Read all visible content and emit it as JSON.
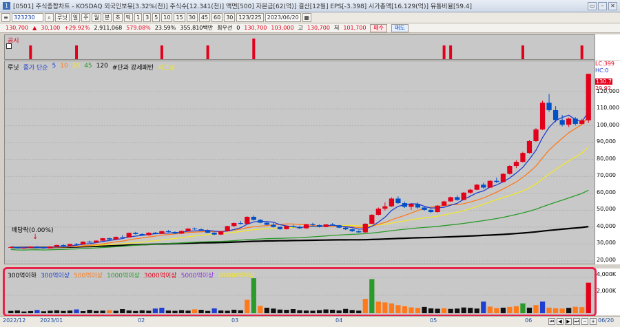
{
  "window": {
    "icon": "1",
    "title": "[0501] 주식종합차트 - KOSDAQ 외국인보유[3.32%(천)] 주식수[12.341(천)] 액면[500] 자본금[62(억)] 결산[12월] EPS[-3.398] 시가총액[16.129(억)] 유통비율[59.4]",
    "buttons": [
      "▭",
      "–",
      "✕"
    ]
  },
  "toolbar": {
    "buttons": [
      "일",
      "주",
      "월",
      "분",
      "초",
      "틱"
    ],
    "period_numbers": [
      "1",
      "3",
      "5",
      "10",
      "15",
      "30",
      "45",
      "60",
      "30"
    ],
    "code": "323230",
    "stock_name": "루닛",
    "count": "123/225",
    "date": "2023/06/20"
  },
  "quote": {
    "price": "130,700",
    "change": "30,100",
    "change_pct": "+29.92%",
    "volume": "2,911,068",
    "amount": "579.08%",
    "turnover": "23.59%",
    "cap": "355,810백만",
    "label_pref": "최우선",
    "zero": "0",
    "last": "130,700",
    "high_label": "고",
    "high": "130,700",
    "low_label": "저",
    "low": "101,700",
    "open": "103,000",
    "buy": "매수",
    "sell": "매도"
  },
  "disclosure": {
    "label": "공시"
  },
  "price_legend": {
    "name": "루닛",
    "ma_label": "종가 단순",
    "ma": [
      "5",
      "10",
      "20",
      "45",
      "120"
    ],
    "pattern": "#단과 강세패턴",
    "signal": "시그널"
  },
  "dividend_label": "배당락(0.00%)",
  "right_axis": {
    "lc": "LC:399",
    "hc": "HC:0",
    "last_price": "130.7",
    "last_change": "29.92",
    "ticks": [
      "120,000",
      "110,000",
      "100,000",
      "90,000",
      "80,000",
      "70,000",
      "60,000",
      "50,000",
      "40,000",
      "30,000",
      "20,000"
    ]
  },
  "volume_legend": {
    "items": [
      "300억이하",
      "300억이상",
      "500억이상",
      "1000억이상",
      "3000억이상",
      "5000억이상",
      "10000억이상"
    ],
    "ticks": [
      "4,000K",
      "2,000K"
    ]
  },
  "x_axis": {
    "labels": [
      "2022/12",
      "2023/01",
      "02",
      "03",
      "04",
      "05",
      "06",
      "06/20"
    ]
  },
  "colors": {
    "up": "#e2001a",
    "down": "#0050c8",
    "ma5": "#1e3fd0",
    "ma10": "#ff7a1a",
    "ma20": "#f2e62b",
    "ma45": "#2a9a2a",
    "ma120": "#000000",
    "vol_300": "#111111",
    "vol_300p": "#1e3fd0",
    "vol_500p": "#ff7a1a",
    "vol_1000p": "#2a9a2a",
    "vol_3000p": "#e2001a",
    "vol_5000p": "#8a2be2",
    "vol_10000p": "#f2e62b"
  },
  "chart_data": {
    "type": "candlestick",
    "price_range": [
      20000,
      130000
    ],
    "candles": [
      [
        28000,
        28500,
        27600,
        28200
      ],
      [
        28200,
        28400,
        27300,
        27500
      ],
      [
        27500,
        27900,
        27100,
        27800
      ],
      [
        27800,
        28600,
        27600,
        28400
      ],
      [
        28400,
        28800,
        27900,
        28000
      ],
      [
        28000,
        28200,
        27200,
        27400
      ],
      [
        27400,
        28600,
        27300,
        28500
      ],
      [
        28500,
        29600,
        28300,
        29400
      ],
      [
        29400,
        29800,
        28700,
        28900
      ],
      [
        28900,
        30200,
        28800,
        30000
      ],
      [
        30000,
        30600,
        29500,
        29700
      ],
      [
        29700,
        31600,
        29600,
        31400
      ],
      [
        31400,
        32000,
        30700,
        30900
      ],
      [
        30900,
        32200,
        30800,
        32000
      ],
      [
        32000,
        33600,
        31700,
        33400
      ],
      [
        33400,
        33800,
        32400,
        32700
      ],
      [
        32700,
        34500,
        32500,
        34200
      ],
      [
        34200,
        35200,
        33600,
        33900
      ],
      [
        33900,
        36800,
        33700,
        36600
      ],
      [
        36600,
        37200,
        35600,
        35900
      ],
      [
        35900,
        36400,
        34900,
        35200
      ],
      [
        35200,
        36900,
        35000,
        36700
      ],
      [
        36700,
        37100,
        35800,
        36000
      ],
      [
        36000,
        37800,
        35900,
        37600
      ],
      [
        37600,
        38300,
        36900,
        37100
      ],
      [
        37100,
        37500,
        35900,
        36200
      ],
      [
        36200,
        37900,
        36000,
        37700
      ],
      [
        37700,
        39300,
        37500,
        39100
      ],
      [
        39100,
        39700,
        38400,
        38700
      ],
      [
        38700,
        39200,
        37800,
        38100
      ],
      [
        38100,
        38600,
        36500,
        36700
      ],
      [
        36700,
        36900,
        35300,
        35600
      ],
      [
        35600,
        37800,
        35400,
        37500
      ],
      [
        37500,
        40800,
        37400,
        40600
      ],
      [
        40600,
        42700,
        40200,
        42400
      ],
      [
        42400,
        43600,
        41500,
        41900
      ],
      [
        41900,
        46400,
        41700,
        46100
      ],
      [
        46100,
        46900,
        43900,
        44300
      ],
      [
        44300,
        44800,
        42300,
        42600
      ],
      [
        42600,
        43100,
        41100,
        41400
      ],
      [
        41400,
        42400,
        39700,
        40100
      ],
      [
        40100,
        40600,
        38400,
        38800
      ],
      [
        38800,
        40900,
        38600,
        40600
      ],
      [
        40600,
        41400,
        39700,
        40100
      ],
      [
        40100,
        40900,
        38900,
        39300
      ],
      [
        39300,
        41900,
        39100,
        41700
      ],
      [
        41700,
        42600,
        40800,
        41200
      ],
      [
        41200,
        41600,
        39800,
        40100
      ],
      [
        40100,
        41800,
        39900,
        41600
      ],
      [
        41600,
        42400,
        40800,
        41100
      ],
      [
        41100,
        41300,
        39400,
        39700
      ],
      [
        39700,
        40200,
        38300,
        38700
      ],
      [
        38700,
        39100,
        37200,
        37600
      ],
      [
        37600,
        38100,
        36600,
        36900
      ],
      [
        36900,
        42200,
        36700,
        42000
      ],
      [
        42000,
        47600,
        41800,
        47300
      ],
      [
        47300,
        51600,
        46900,
        50900
      ],
      [
        50900,
        54600,
        49800,
        52300
      ],
      [
        52300,
        57600,
        51900,
        56900
      ],
      [
        56900,
        58200,
        53700,
        54200
      ],
      [
        54200,
        55100,
        51400,
        52000
      ],
      [
        52000,
        54200,
        50200,
        53700
      ],
      [
        53700,
        54600,
        50900,
        51600
      ],
      [
        51600,
        52400,
        49700,
        50200
      ],
      [
        50200,
        50900,
        48400,
        48900
      ],
      [
        48900,
        53100,
        48600,
        52700
      ],
      [
        52700,
        55600,
        52400,
        55200
      ],
      [
        55200,
        58100,
        54900,
        57700
      ],
      [
        57700,
        58800,
        55600,
        56100
      ],
      [
        56100,
        60800,
        55900,
        60400
      ],
      [
        60400,
        62700,
        59500,
        62100
      ],
      [
        62100,
        65600,
        61800,
        65100
      ],
      [
        65100,
        66300,
        62800,
        63400
      ],
      [
        63400,
        67700,
        63100,
        67400
      ],
      [
        67400,
        69300,
        66100,
        66700
      ],
      [
        66700,
        71900,
        66400,
        71500
      ],
      [
        71500,
        76600,
        71100,
        76200
      ],
      [
        76200,
        79600,
        74900,
        78600
      ],
      [
        78600,
        84600,
        78200,
        83900
      ],
      [
        83900,
        91600,
        83500,
        90900
      ],
      [
        90900,
        98600,
        90400,
        97800
      ],
      [
        97800,
        114800,
        97400,
        113600
      ],
      [
        113600,
        118800,
        108200,
        109200
      ],
      [
        109200,
        111600,
        102100,
        103400
      ],
      [
        103400,
        106400,
        99600,
        100600
      ],
      [
        100600,
        104800,
        99200,
        104200
      ],
      [
        104200,
        105100,
        100200,
        101100
      ],
      [
        101100,
        104100,
        100600,
        103200
      ],
      [
        103200,
        130700,
        101700,
        130700
      ]
    ],
    "volume_kilo": [
      260,
      310,
      190,
      240,
      360,
      210,
      280,
      330,
      250,
      300,
      420,
      230,
      380,
      260,
      290,
      340,
      270,
      460,
      310,
      250,
      330,
      280,
      520,
      610,
      300,
      270,
      350,
      290,
      430,
      380,
      260,
      540,
      310,
      280,
      390,
      330,
      1500,
      3900,
      820,
      610,
      520,
      410,
      380,
      460,
      340,
      300,
      280,
      350,
      420,
      390,
      310,
      480,
      360,
      290,
      1600,
      3800,
      1300,
      1200,
      1100,
      900,
      780,
      650,
      600,
      700,
      540,
      500,
      560,
      480,
      520,
      640,
      600,
      520,
      1300,
      740,
      580,
      620,
      700,
      780,
      1100,
      620,
      900,
      1300,
      620,
      560,
      520,
      600,
      720,
      680,
      3400
    ],
    "volume_colors": [
      0,
      0,
      0,
      0,
      1,
      0,
      0,
      0,
      0,
      0,
      1,
      0,
      0,
      0,
      0,
      2,
      0,
      0,
      0,
      0,
      0,
      0,
      1,
      1,
      0,
      0,
      0,
      0,
      2,
      0,
      0,
      1,
      0,
      0,
      0,
      0,
      2,
      3,
      2,
      0,
      0,
      0,
      0,
      0,
      0,
      0,
      0,
      0,
      0,
      0,
      0,
      0,
      0,
      0,
      2,
      3,
      2,
      2,
      2,
      2,
      2,
      2,
      2,
      0,
      0,
      0,
      2,
      0,
      0,
      0,
      0,
      0,
      1,
      2,
      2,
      0,
      2,
      2,
      3,
      0,
      2,
      1,
      2,
      2,
      2,
      0,
      2,
      2,
      4
    ]
  }
}
